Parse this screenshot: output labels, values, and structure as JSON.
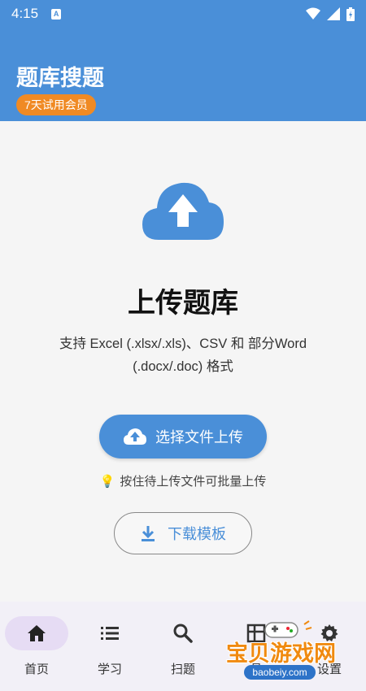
{
  "status_bar": {
    "time": "4:15",
    "indicator": "A"
  },
  "header": {
    "title": "题库搜题",
    "trial_badge": "7天试用会员",
    "accent_color": "#4a8fd8",
    "badge_color": "#f08a24"
  },
  "main": {
    "icon": "cloud-upload-icon",
    "title": "上传题库",
    "description": "支持 Excel (.xlsx/.xls)、CSV 和 部分Word (.docx/.doc) 格式",
    "select_button_label": "选择文件上传",
    "hint": "按住待上传文件可批量上传",
    "download_button_label": "下载模板"
  },
  "bottom_nav": {
    "items": [
      {
        "label": "首页",
        "icon": "home-icon",
        "active": true
      },
      {
        "label": "学习",
        "icon": "list-icon",
        "active": false
      },
      {
        "label": "扫题",
        "icon": "search-icon",
        "active": false
      },
      {
        "label": "悬",
        "icon": "grid-icon",
        "active": false
      },
      {
        "label": "设置",
        "icon": "gear-icon",
        "active": false
      }
    ]
  },
  "watermark": {
    "text": "宝贝游戏网",
    "url": "baobeiy.com"
  }
}
